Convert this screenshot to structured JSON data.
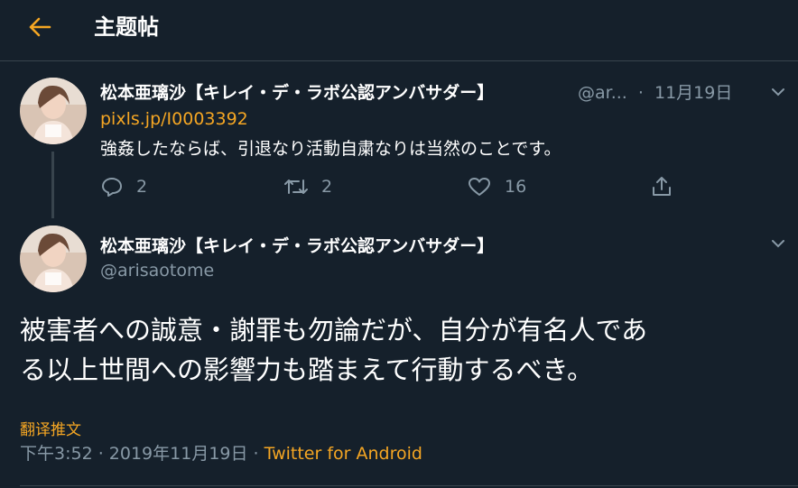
{
  "header": {
    "title": "主题帖"
  },
  "reply_tweet": {
    "display_name": "松本亜璃沙【キレイ・デ・ラボ公認アンバサダー】",
    "handle": "@ar...",
    "separator": "·",
    "date": "11月19日",
    "link": "pixls.jp/I0003392",
    "text": "強姦したならば、引退なり活動自粛なりは当然のことです。",
    "replies": "2",
    "retweets": "2",
    "likes": "16"
  },
  "main_tweet": {
    "display_name": "松本亜璃沙【キレイ・デ・ラボ公認アンバサダー】",
    "handle": "@arisaotome",
    "text_line1": "被害者への誠意・謝罪も勿論だが、自分が有名人であ",
    "text_line2": "る以上世間への影響力も踏まえて行動するべき。",
    "translate_label": "翻译推文",
    "timestamp": "下午3:52 · 2019年11月19日 · ",
    "source": "Twitter for Android"
  },
  "colors": {
    "background": "#15202b",
    "accent": "#f5a623",
    "muted": "#8899a6",
    "divider": "#38444d"
  }
}
